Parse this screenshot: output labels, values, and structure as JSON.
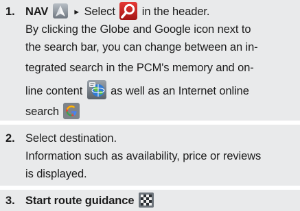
{
  "steps": [
    {
      "number": "1.",
      "lines": {
        "l1_bold": "NAV",
        "l1_arrow": "►",
        "l1_text_a": "Select",
        "l1_text_b": "in the header.",
        "l2": "By clicking the Globe and Google icon next to",
        "l3": "the search bar, you can change between an in-",
        "l4": "tegrated search in the PCM's memory and on-",
        "l5_a": "line content",
        "l5_b": "as well as an Internet online",
        "l6": "search"
      },
      "icons": [
        "nav-icon",
        "search-icon",
        "globe-icon",
        "google-icon"
      ]
    },
    {
      "number": "2.",
      "lines": {
        "l1": "Select destination.",
        "l2": "Information such as availability, price or reviews",
        "l3": "is displayed."
      }
    },
    {
      "number": "3.",
      "lines": {
        "l1_bold": "Start route guidance"
      },
      "icons": [
        "checkered-flag-icon"
      ]
    }
  ],
  "colors": {
    "panel_background": "#e9eaeb",
    "text": "#1b1b1b",
    "search_icon_accent": "#c62828",
    "icon_tile": "#8a8f95"
  }
}
